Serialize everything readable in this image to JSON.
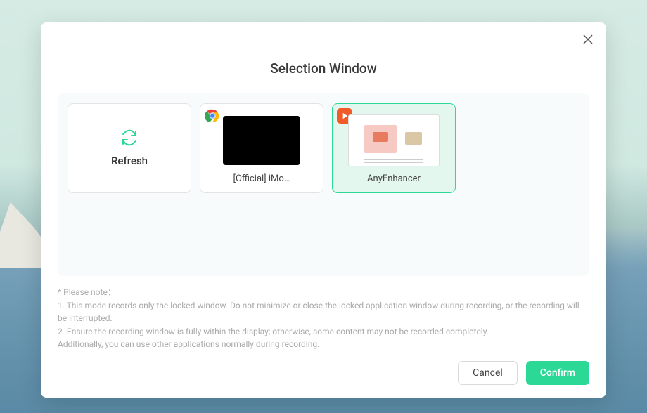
{
  "dialog": {
    "title": "Selection Window",
    "cards": {
      "refresh": {
        "label": "Refresh"
      },
      "chrome": {
        "label": "[Official] iMo…",
        "icon": "chrome-icon"
      },
      "anyenhancer": {
        "label": "AnyEnhancer",
        "icon": "imyfone-icon",
        "selected": true
      }
    },
    "notes": {
      "header": "* Please note：",
      "line1": "1. This mode records only the locked window. Do not minimize or close the locked application window during recording, or the recording will be interrupted.",
      "line2": "2. Ensure the recording window is fully within the display; otherwise, some content may not be recorded completely.",
      "line3": "Additionally, you can use other applications normally during recording."
    },
    "buttons": {
      "cancel": "Cancel",
      "confirm": "Confirm"
    }
  },
  "colors": {
    "accent": "#2bd895"
  }
}
